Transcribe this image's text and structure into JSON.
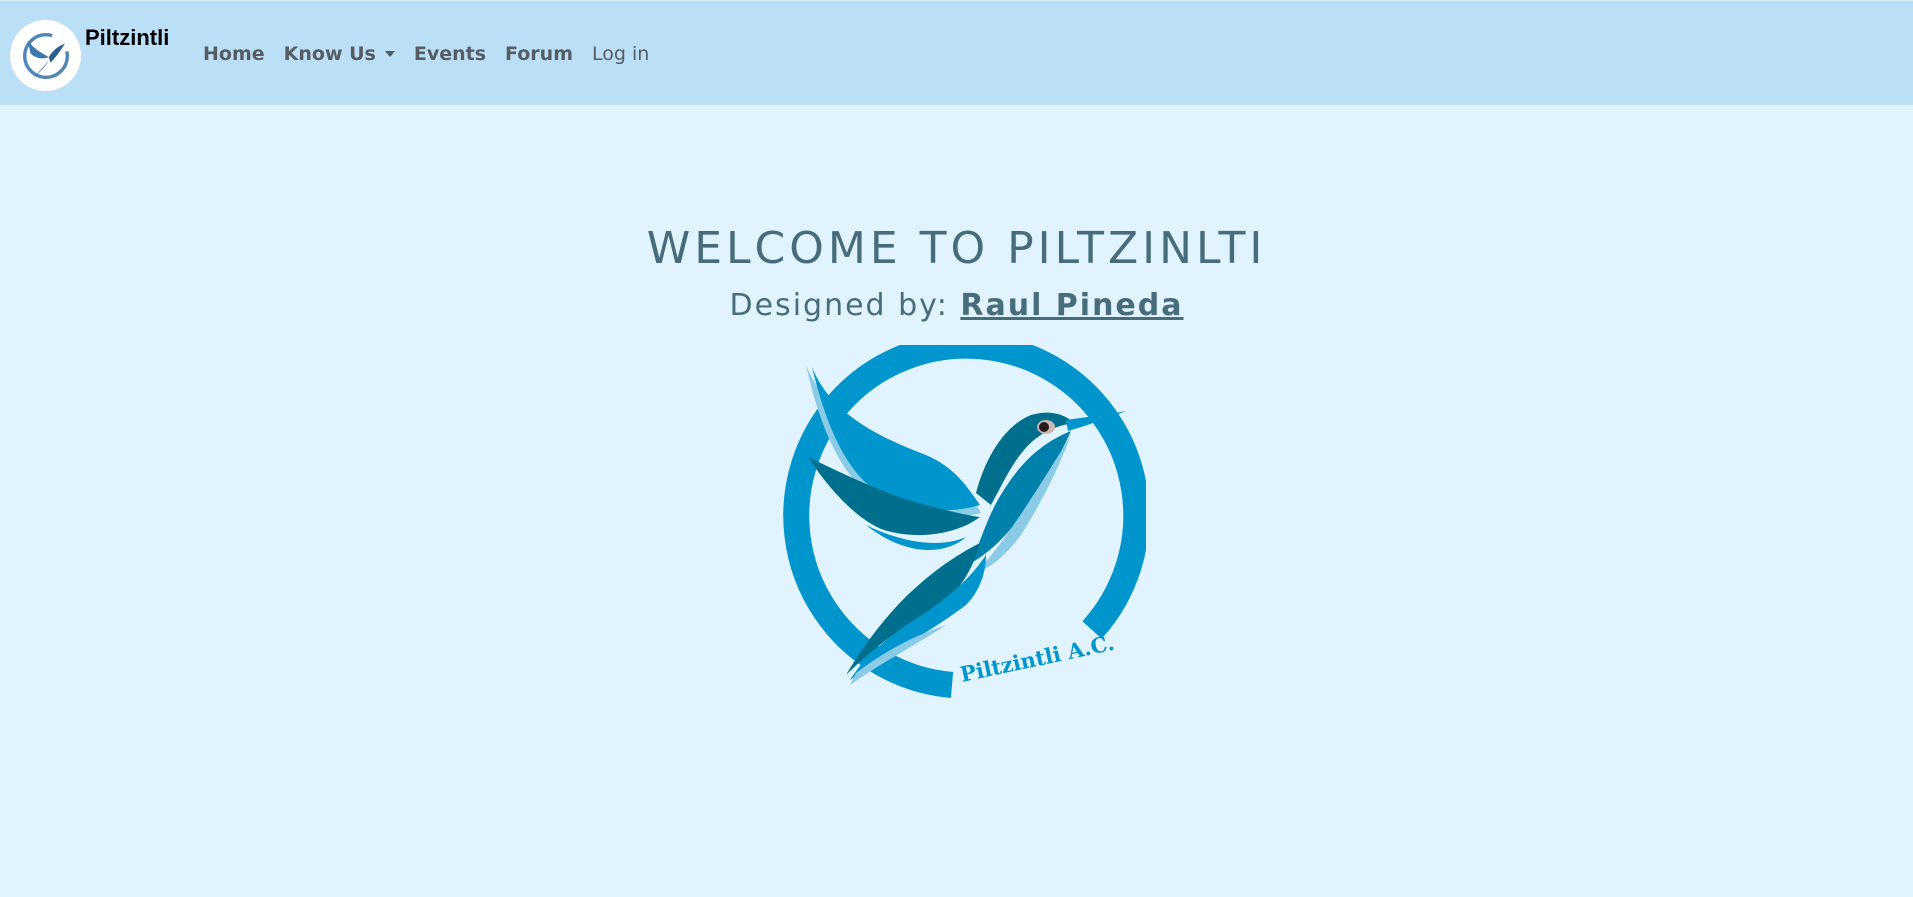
{
  "brand": {
    "name": "Piltzintli",
    "logo_icon": "hummingbird-logo-icon"
  },
  "nav": {
    "items": [
      {
        "label": "Home"
      },
      {
        "label": "Know Us"
      },
      {
        "label": "Events"
      },
      {
        "label": "Forum"
      },
      {
        "label": "Log in"
      }
    ]
  },
  "hero": {
    "title": "WELCOME TO PILTZINLTI",
    "designed_by_prefix": "Designed by: ",
    "designer_name": "Raul Pineda",
    "logo_text": "Piltzintli A.C."
  },
  "colors": {
    "navbar_bg": "#bbdff6",
    "page_bg": "#e1f3fd",
    "accent_blue": "#0095cc",
    "dark_teal": "#006f8e",
    "text_slate": "#476d7c"
  }
}
